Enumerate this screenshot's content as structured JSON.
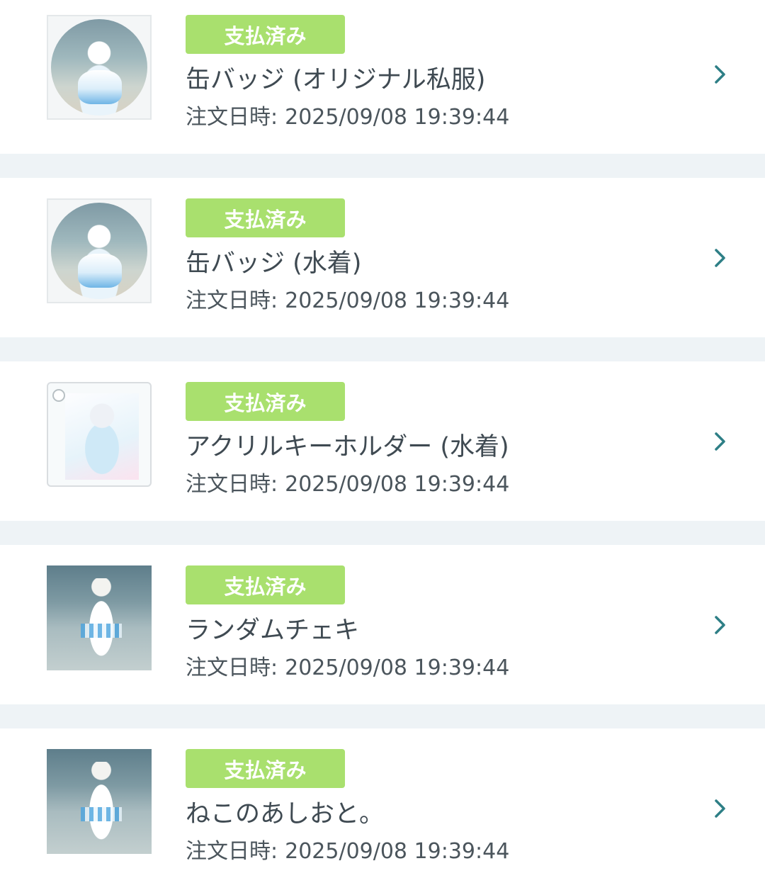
{
  "orders": [
    {
      "status": "支払済み",
      "title": "缶バッジ (オリジナル私服)",
      "date_label": "注文日時:",
      "date_value": "2025/09/08 19:39:44",
      "thumb": "can-badge-image"
    },
    {
      "status": "支払済み",
      "title": "缶バッジ (水着)",
      "date_label": "注文日時:",
      "date_value": "2025/09/08 19:39:44",
      "thumb": "can-badge-image"
    },
    {
      "status": "支払済み",
      "title": "アクリルキーホルダー (水着)",
      "date_label": "注文日時:",
      "date_value": "2025/09/08 19:39:44",
      "thumb": "acrylic-keychain-image"
    },
    {
      "status": "支払済み",
      "title": "ランダムチェキ",
      "date_label": "注文日時:",
      "date_value": "2025/09/08 19:39:44",
      "thumb": "cheki-photo-image"
    },
    {
      "status": "支払済み",
      "title": "ねこのあしおと。",
      "date_label": "注文日時:",
      "date_value": "2025/09/08 19:39:44",
      "thumb": "photo-image"
    }
  ],
  "colors": {
    "status_badge_bg": "#a9e06e",
    "chevron": "#2e7f86",
    "page_bg": "#eef3f6",
    "text": "#3f4a52"
  },
  "icons": {
    "chevron": "chevron-right-icon"
  }
}
